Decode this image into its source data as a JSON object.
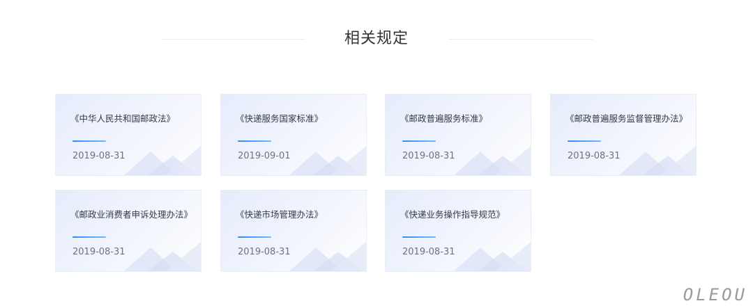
{
  "section": {
    "title": "相关规定"
  },
  "cards": [
    {
      "title": "《中华人民共和国邮政法》",
      "date": "2019-08-31"
    },
    {
      "title": "《快递服务国家标准》",
      "date": "2019-09-01"
    },
    {
      "title": "《邮政普遍服务标准》",
      "date": "2019-08-31"
    },
    {
      "title": "《邮政普遍服务监督管理办法》",
      "date": "2019-08-31"
    },
    {
      "title": "《邮政业消费者申诉处理办法》",
      "date": "2019-08-31"
    },
    {
      "title": "《快递市场管理办法》",
      "date": "2019-08-31"
    },
    {
      "title": "《快递业务操作指导规范》",
      "date": "2019-08-31"
    }
  ],
  "watermark": "OLEOU",
  "colors": {
    "accent": "#2d8cf0",
    "card_bg": "#e6ecfb",
    "title_text": "#333333",
    "date_text": "#6b7384"
  },
  "icons": {
    "card_decoration": "mountain-shapes-icon"
  }
}
